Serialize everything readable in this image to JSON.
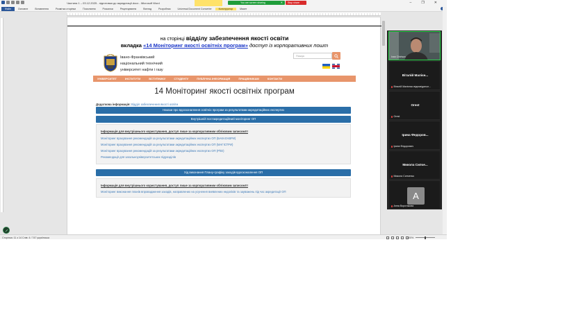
{
  "word": {
    "title": "Частина 1 – 03.12.2025 - підготовка до акредитації.docx  -  Microsoft Word",
    "tabs": [
      "Файл",
      "Основне",
      "Вставлення",
      "Розмітка сторінки",
      "Посилання",
      "Розсилки",
      "Рецензування",
      "Вигляд",
      "Розробник",
      "Universal Document Converter",
      "Конструктор",
      "Макет"
    ],
    "status_left": "Сторінка: 11 з 14   Слів: 4 / 747   українська",
    "zoom": "100%"
  },
  "share": {
    "sharing_label": "You are screen sharing",
    "stop_label": "Stop share"
  },
  "page": {
    "line1_pre": "на сторінці ",
    "line1_bold": "відділу забезпечення якості освіти",
    "line2_pre": "вкладка ",
    "line2_link": "«14 Моніторинг якості освітніх програм»",
    "line2_post": " доступ із корпоративних пошт",
    "university": [
      "Івано-Франківський",
      "національний технічний",
      "університет нафти і газу"
    ],
    "search_placeholder": "Пошук",
    "nav": [
      "УНІВЕРСИТЕТ",
      "ІНСТИТУТИ",
      "ВСТУПНИКУ",
      "СТУДЕНТУ",
      "ПУБЛІЧНА ІНФОРМАЦІЯ",
      "ПРАЦІВНИКАМ",
      "КОНТАКТИ"
    ],
    "heading": "14 Моніторинг якості освітніх програм",
    "addinfo_label": "Додаткова інформація:",
    "addinfo_link": "Відділ забезпечення якості освіти",
    "bar1": "Накази про вдосконалення освітніх програм за результатами акредитаційних експертиз",
    "bar2": "Внутрішній постакредитаційний моніторинг ОП",
    "panel1_warning": "Інформація для внутрішнього користування, доступ лише за корпоративним обліковим записом!!!",
    "panel1_links": [
      "Моніторинг врахування рекомендацій за результатами акредитаційних експертиз ОП (БАКАЛАВРИ)",
      "Моніторинг врахування рекомендацій за результатами акредитаційних експертиз ОП (МАГІСТРИ)",
      "Моніторинг врахування рекомендацій за результатами акредитаційних експертиз ОП (PhD)",
      "Рекомендації для загальноуніверситетських підрозділів"
    ],
    "bar3": "Хід виконання Плану-графіку заходів вдосконалення ОП",
    "panel2_warning": "Інформація для внутрішнього користування, доступ лише за корпоративним обліковим записом!!!",
    "panel2_link": "Моніторинг виконання планів впровадження заходів, направлених на усунення виявлених недоліків та зауважень під час акредитації ОП"
  },
  "meeting": {
    "self_label": "Ivan Chirtsov",
    "participants": [
      {
        "display": "Віталій Малієн...",
        "label": "Віталій Малієнко відповідальн..."
      },
      {
        "display": "Orest",
        "label": "Orest"
      },
      {
        "display": "Ірина Федоров...",
        "label": "Ірина Федорович"
      },
      {
        "display": "Микола Сипче...",
        "label": "Микола Сипченко"
      },
      {
        "display": "A",
        "label": "Анна Ворстакова"
      }
    ]
  },
  "colors": {
    "accent": "#2b579a",
    "nav": "#e8956b",
    "bluebar": "#2a6ea8",
    "share_green": "#1f9d3a",
    "stop_red": "#d92b2b"
  }
}
